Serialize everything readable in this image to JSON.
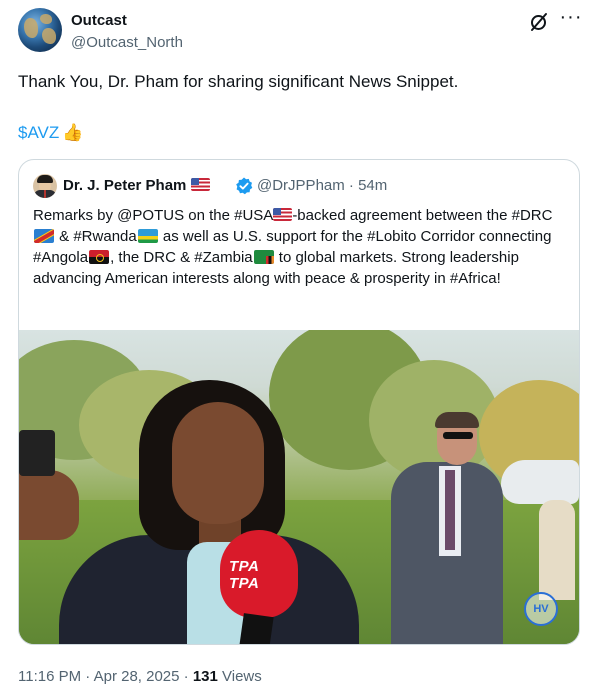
{
  "author": {
    "name": "Outcast",
    "handle": "@Outcast_North"
  },
  "tweet": {
    "text": "Thank You, Dr. Pham for sharing significant News Snippet.",
    "cashtag": "$AVZ"
  },
  "quoted": {
    "name": "Dr. J. Peter Pham",
    "handle_time": "@DrJPPham · 54m",
    "text_parts": {
      "p1": "Remarks by @POTUS on the #USA",
      "p2": "-backed agreement between the #DRC",
      "p3": " & #Rwanda",
      "p4": " as well as U.S. support for the #Lobito Corridor connecting #Angola",
      "p5": ", the DRC & #Zambia",
      "p6": " to global markets. Strong leadership advancing American interests along with peace & prosperity in #Africa!"
    },
    "video": {
      "mic_label": "TPA TPA",
      "watermark": "HV"
    }
  },
  "footer": {
    "time": "11:16 PM · Apr 28, 2025 · ",
    "views_count": "131",
    "views_label": " Views"
  },
  "colors": {
    "link": "#1d9bf0",
    "secondary_text": "#536471",
    "verified": "#1d9bf0",
    "border": "#cfd9de"
  }
}
